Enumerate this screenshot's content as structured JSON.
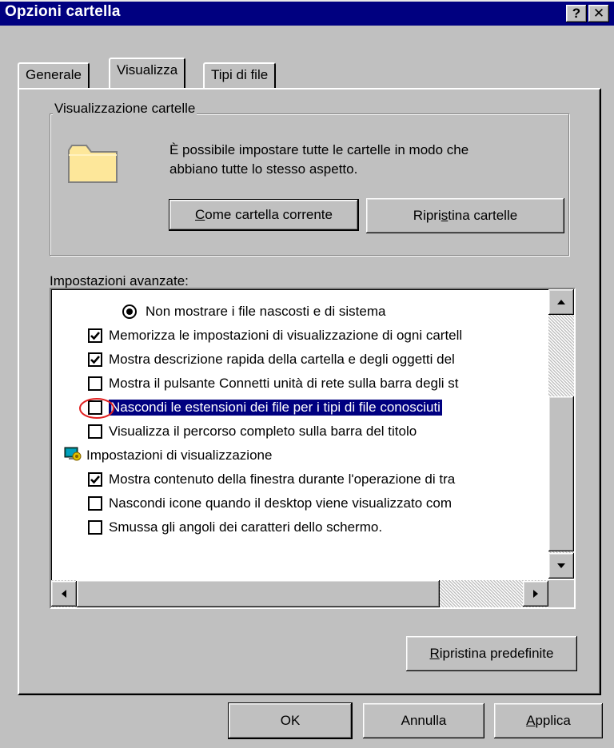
{
  "window": {
    "title": "Opzioni cartella",
    "help_label": "?",
    "close_label": "✕"
  },
  "tabs": [
    {
      "label": "Generale"
    },
    {
      "label": "Visualizza"
    },
    {
      "label": "Tipi di file"
    }
  ],
  "folder_view": {
    "group_label": "Visualizzazione cartelle",
    "description_line1": "È possibile impostare tutte le cartelle in modo che",
    "description_line2": "abbiano tutte lo stesso aspetto.",
    "current_button_mnemonic": "C",
    "current_button_rest": "ome cartella corrente",
    "reset_button_pre": "Ripri",
    "reset_button_mnemonic": "s",
    "reset_button_post": "tina cartelle"
  },
  "advanced": {
    "label": "Impostazioni avanzate:",
    "items": [
      {
        "type": "radio",
        "checked": true,
        "label": "Non mostrare i file nascosti e di sistema"
      },
      {
        "type": "checkbox",
        "checked": true,
        "label": "Memorizza le impostazioni di visualizzazione di ogni cartell"
      },
      {
        "type": "checkbox",
        "checked": true,
        "label": "Mostra descrizione rapida della cartella e degli oggetti del"
      },
      {
        "type": "checkbox",
        "checked": false,
        "label": "Mostra il pulsante Connetti unità di rete sulla barra degli st"
      },
      {
        "type": "checkbox",
        "checked": false,
        "selected": true,
        "label": "Nascondi le estensioni dei file per i tipi di file conosciuti"
      },
      {
        "type": "checkbox",
        "checked": false,
        "label": "Visualizza il percorso completo sulla barra del titolo"
      },
      {
        "type": "group",
        "icon": "display-settings-icon",
        "label": "Impostazioni di visualizzazione"
      },
      {
        "type": "checkbox",
        "checked": true,
        "label": "Mostra contenuto della finestra durante l'operazione di tra"
      },
      {
        "type": "checkbox",
        "checked": false,
        "label": "Nascondi icone quando il desktop viene visualizzato com"
      },
      {
        "type": "checkbox",
        "checked": false,
        "label": "Smussa gli angoli dei caratteri dello schermo."
      }
    ],
    "restore_defaults_mnemonic": "R",
    "restore_defaults_rest": "ipristina predefinite"
  },
  "footer": {
    "ok_label": "OK",
    "cancel_label": "Annulla",
    "apply_mnemonic": "A",
    "apply_rest": "pplica"
  },
  "colors": {
    "titlebar": "#000080",
    "face": "#c0c0c0",
    "highlight_circle": "#e02020"
  }
}
